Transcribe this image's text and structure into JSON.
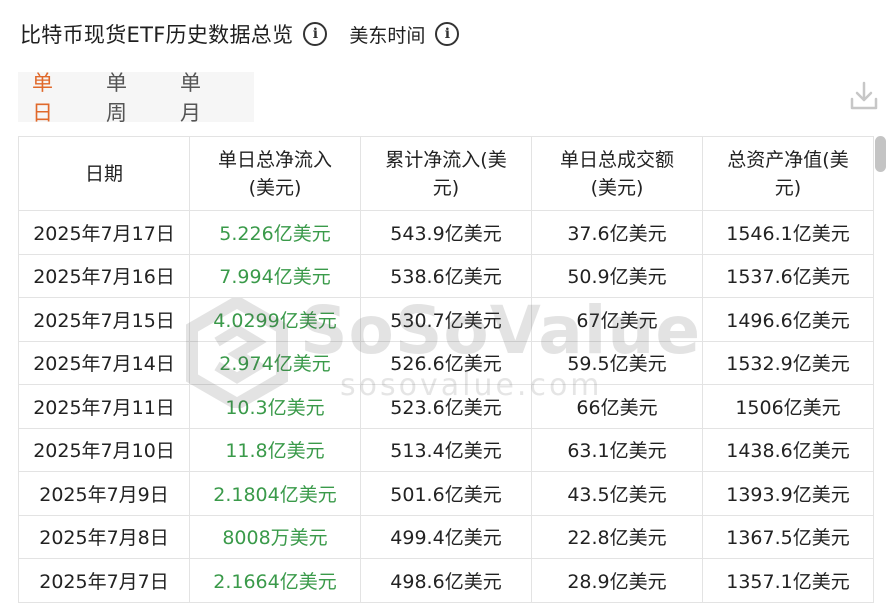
{
  "header": {
    "title": "比特币现货ETF历史数据总览",
    "timezone": "美东时间"
  },
  "tabs": [
    {
      "label": "单日",
      "active": true
    },
    {
      "label": "单周",
      "active": false
    },
    {
      "label": "单月",
      "active": false
    }
  ],
  "table": {
    "columns": [
      "日期",
      "单日总净流入\n(美元)",
      "累计净流入(美\n元)",
      "单日总成交额\n(美元)",
      "总资产净值(美\n元)"
    ],
    "rows": [
      {
        "date": "2025年7月17日",
        "daily_net_inflow": "5.226亿美元",
        "cumulative_net_inflow": "543.9亿美元",
        "daily_volume": "37.6亿美元",
        "total_net_assets": "1546.1亿美元"
      },
      {
        "date": "2025年7月16日",
        "daily_net_inflow": "7.994亿美元",
        "cumulative_net_inflow": "538.6亿美元",
        "daily_volume": "50.9亿美元",
        "total_net_assets": "1537.6亿美元"
      },
      {
        "date": "2025年7月15日",
        "daily_net_inflow": "4.0299亿美元",
        "cumulative_net_inflow": "530.7亿美元",
        "daily_volume": "67亿美元",
        "total_net_assets": "1496.6亿美元"
      },
      {
        "date": "2025年7月14日",
        "daily_net_inflow": "2.974亿美元",
        "cumulative_net_inflow": "526.6亿美元",
        "daily_volume": "59.5亿美元",
        "total_net_assets": "1532.9亿美元"
      },
      {
        "date": "2025年7月11日",
        "daily_net_inflow": "10.3亿美元",
        "cumulative_net_inflow": "523.6亿美元",
        "daily_volume": "66亿美元",
        "total_net_assets": "1506亿美元"
      },
      {
        "date": "2025年7月10日",
        "daily_net_inflow": "11.8亿美元",
        "cumulative_net_inflow": "513.4亿美元",
        "daily_volume": "63.1亿美元",
        "total_net_assets": "1438.6亿美元"
      },
      {
        "date": "2025年7月9日",
        "daily_net_inflow": "2.1804亿美元",
        "cumulative_net_inflow": "501.6亿美元",
        "daily_volume": "43.5亿美元",
        "total_net_assets": "1393.9亿美元"
      },
      {
        "date": "2025年7月8日",
        "daily_net_inflow": "8008万美元",
        "cumulative_net_inflow": "499.4亿美元",
        "daily_volume": "22.8亿美元",
        "total_net_assets": "1367.5亿美元"
      },
      {
        "date": "2025年7月7日",
        "daily_net_inflow": "2.1664亿美元",
        "cumulative_net_inflow": "498.6亿美元",
        "daily_volume": "28.9亿美元",
        "total_net_assets": "1357.1亿美元"
      }
    ]
  },
  "watermark": {
    "brand": "SoSoValue",
    "site": "sosovalue.com"
  },
  "colors": {
    "accent": "#e0692b",
    "positive": "#3a9a4a"
  },
  "icons": [
    "info-icon",
    "download-icon"
  ]
}
